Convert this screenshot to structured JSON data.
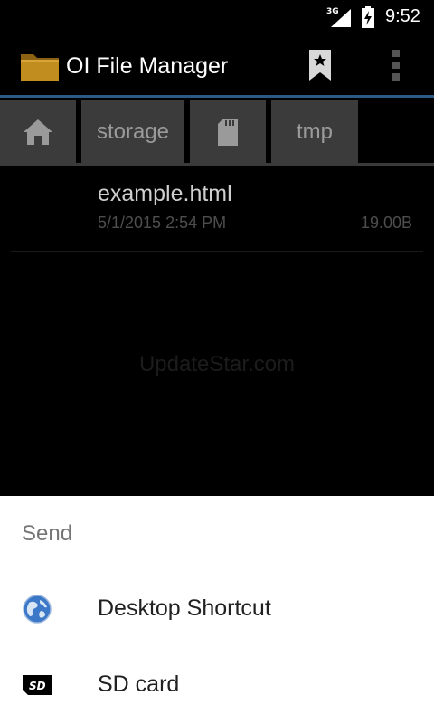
{
  "status_bar": {
    "network": "3G",
    "time": "9:52",
    "icons": [
      "signal-icon",
      "battery-charging-icon"
    ]
  },
  "action_bar": {
    "title": "OI File Manager",
    "icons": [
      "folder-app-icon",
      "bookmark-icon",
      "overflow-menu-icon"
    ],
    "accent_color": "#2c5a84"
  },
  "path_bar": {
    "crumbs": [
      {
        "type": "icon",
        "icon": "home-icon"
      },
      {
        "type": "text",
        "label": "storage"
      },
      {
        "type": "icon",
        "icon": "sd-card-icon"
      },
      {
        "type": "text",
        "label": "tmp"
      }
    ]
  },
  "files": [
    {
      "name": "example.html",
      "date": "5/1/2015 2:54 PM",
      "size": "19.00B"
    }
  ],
  "watermark": "UpdateStar.com",
  "send_sheet": {
    "title": "Send",
    "items": [
      {
        "label": "Desktop Shortcut",
        "icon": "globe-icon"
      },
      {
        "label": "SD card",
        "icon": "sd-card-icon"
      }
    ]
  }
}
